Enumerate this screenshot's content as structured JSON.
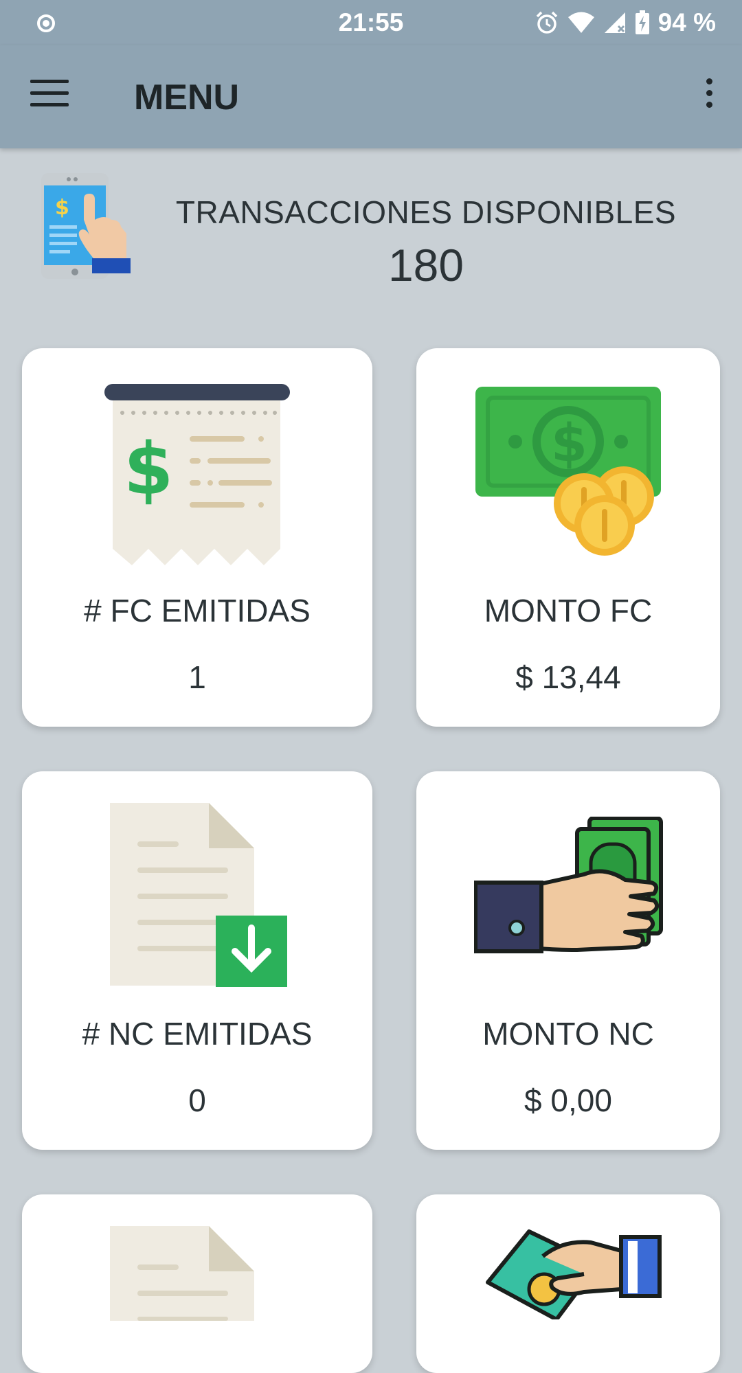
{
  "status_bar": {
    "time": "21:55",
    "battery_percent": "94 %",
    "icons": [
      "circle-dot-icon",
      "alarm-icon",
      "wifi-icon",
      "signal-icon",
      "battery-charging-icon"
    ]
  },
  "app_bar": {
    "title": "MENU",
    "icons": [
      "hamburger-menu-icon",
      "more-vert-icon"
    ]
  },
  "header": {
    "label": "TRANSACCIONES DISPONIBLES",
    "count": "180",
    "icon": "phone-tap-payment-icon"
  },
  "cards": [
    {
      "title": "# FC EMITIDAS",
      "value": "1",
      "icon": "receipt-icon"
    },
    {
      "title": "MONTO FC",
      "value": "$ 13,44",
      "icon": "money-coins-icon"
    },
    {
      "title": "# NC EMITIDAS",
      "value": "0",
      "icon": "document-download-icon"
    },
    {
      "title": "MONTO NC",
      "value": "$ 0,00",
      "icon": "hand-money-icon"
    },
    {
      "title": "",
      "value": "",
      "icon": "document-icon"
    },
    {
      "title": "",
      "value": "",
      "icon": "hand-giving-money-icon"
    }
  ],
  "colors": {
    "app_bar": "#8fa4b3",
    "background": "#c9d0d5",
    "card": "#ffffff",
    "text": "#2b3337",
    "money_green": "#3db54a"
  }
}
